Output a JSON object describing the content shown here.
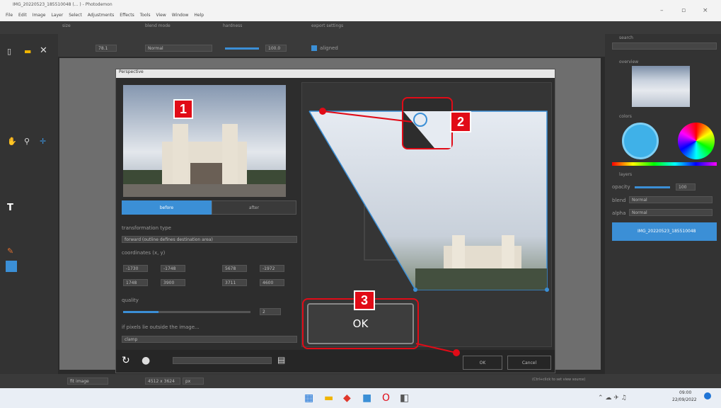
{
  "window": {
    "title": "IMG_20220523_185510048 (... ) - Photodemon",
    "menus": [
      "File",
      "Edit",
      "Image",
      "Layer",
      "Select",
      "Adjustments",
      "Effects",
      "Tools",
      "View",
      "Window",
      "Help"
    ]
  },
  "toolbar": {
    "size_label": "size",
    "blend_label": "blend mode",
    "hardness_label": "hardness",
    "export_label": "export settings",
    "size_value": "78.1",
    "blend_value": "Normal",
    "hardness_value": "100.0",
    "aligned_label": "aligned"
  },
  "dialog": {
    "title": "Perspective",
    "tabs": [
      "before",
      "after"
    ],
    "transform_label": "transformation type",
    "transform_value": "forward (outline defines destination area)",
    "coords_label": "coordinates (x, y)",
    "coords": [
      "-1730",
      "-1748",
      "5678",
      "-1972",
      "1748",
      "3900",
      "3711",
      "4600"
    ],
    "quality_label": "quality",
    "quality_value": "2",
    "outside_label": "if pixels lie outside the image...",
    "outside_value": "clamp",
    "ok_label": "OK",
    "ok_small": "OK",
    "cancel_label": "Cancel"
  },
  "callouts": {
    "one": "1",
    "two": "2",
    "three": "3"
  },
  "right": {
    "search": "search",
    "overview": "overview",
    "colors": "colors",
    "layers": "layers",
    "opacity_label": "opacity",
    "opacity_value": "100",
    "layer_blend_label": "blend",
    "layer_blend_value": "Normal",
    "alpha_label": "alpha",
    "alpha_value": "Normal",
    "layer_name": "IMG_20220523_185510048"
  },
  "status": {
    "zoom": "fit image",
    "size": "4512 x 3624",
    "unit": "px",
    "hint": "(Ctrl+click to set view source)"
  },
  "taskbar": {
    "time": "09:00",
    "date": "22/09/2022"
  },
  "colors": {
    "accent": "#3b8fd6",
    "callout": "#e10b17"
  }
}
